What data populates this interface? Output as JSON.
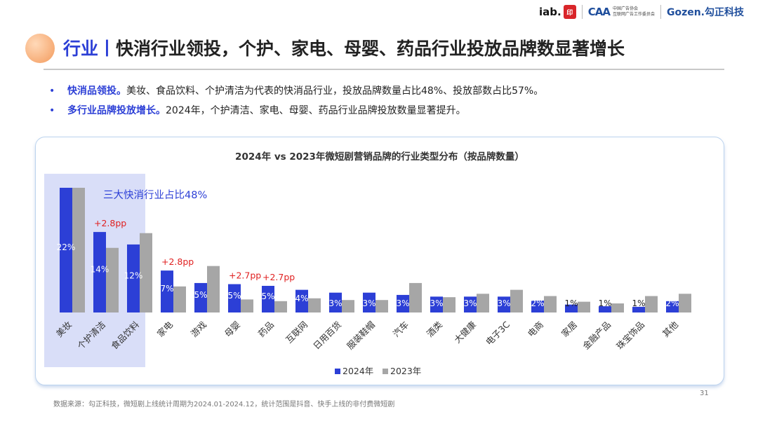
{
  "logos": {
    "iab": "iab.",
    "caa_mark": "CAA",
    "caa_line1": "中国广告协会",
    "caa_line2": "互联网广告工作委员会",
    "gozen": "Gozen.勾正科技"
  },
  "title": {
    "prefix": "行业丨",
    "text": "快消行业领投，个护、家电、母婴、药品行业投放品牌数显著增长"
  },
  "bullets": [
    {
      "highlight": "快消品领投。",
      "text": "美妆、食品饮料、个护清洁为代表的快消品行业，投放品牌数量占比48%、投放部数占比57%。"
    },
    {
      "highlight": "多行业品牌投放增长。",
      "text": "2024年，个护清洁、家电、母婴、药品行业品牌投放数量显著提升。"
    }
  ],
  "chart_data": {
    "type": "bar",
    "title": "2024年 vs 2023年微短剧营销品牌的行业类型分布（按品牌数量）",
    "categories": [
      "美妆",
      "个护清洁",
      "食品饮料",
      "家电",
      "游戏",
      "母婴",
      "药品",
      "互联网",
      "日用百货",
      "服装鞋帽",
      "汽车",
      "酒类",
      "大健康",
      "电子3C",
      "电商",
      "家居",
      "金融产品",
      "珠宝饰品",
      "其他"
    ],
    "series": [
      {
        "name": "2024年",
        "color": "#2c3fd6",
        "values": [
          22.0,
          14.2,
          12.0,
          7.4,
          5.2,
          5.0,
          4.7,
          4.0,
          3.5,
          3.5,
          3.1,
          2.8,
          2.8,
          2.8,
          2.1,
          1.4,
          1.1,
          1.0,
          2.0
        ],
        "labels": [
          "22%",
          "14%",
          "12%",
          "7%",
          "5%",
          "5%",
          "5%",
          "4%",
          "3%",
          "3%",
          "3%",
          "3%",
          "3%",
          "3%",
          "2%",
          "1%",
          "1%",
          "1%",
          "2%"
        ]
      },
      {
        "name": "2023年",
        "color": "#a6a6a6",
        "values": [
          22.0,
          11.4,
          14.0,
          4.6,
          8.2,
          2.3,
          2.0,
          2.5,
          2.2,
          2.2,
          5.2,
          2.7,
          3.3,
          4.0,
          2.9,
          1.9,
          1.6,
          2.9,
          3.3
        ]
      }
    ],
    "annotations": [
      {
        "category": "个护清洁",
        "text": "+2.8pp"
      },
      {
        "category": "家电",
        "text": "+2.8pp"
      },
      {
        "category": "母婴",
        "text": "+2.7pp"
      },
      {
        "category": "药品",
        "text": "+2.7pp"
      }
    ],
    "highlight": {
      "categories": [
        "美妆",
        "个护清洁",
        "食品饮料"
      ],
      "label": "三大快消行业占比48%"
    },
    "annotation_color": "#e02020",
    "legend_position": "bottom-center"
  },
  "source": "数据来源：勾正科技，微短剧上线统计周期为2024.01-2024.12，统计范围是抖音、快手上线的非付费微短剧",
  "page_number": "31"
}
